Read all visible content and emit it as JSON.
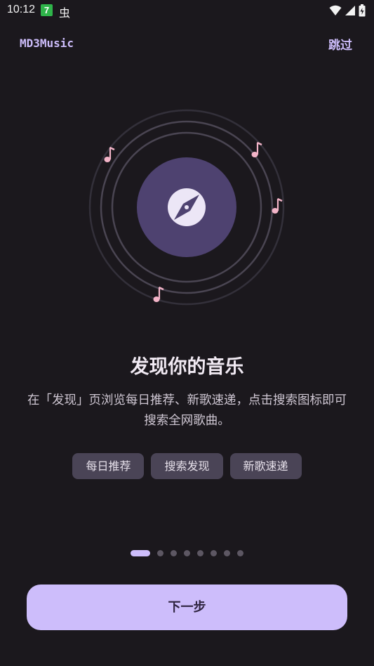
{
  "status_bar": {
    "time": "10:12",
    "badge": "7",
    "bug_glyph": "虫"
  },
  "app": {
    "title": "MD3Music",
    "skip_label": "跳过"
  },
  "onboarding": {
    "heading": "发现你的音乐",
    "description": "在「发现」页浏览每日推荐、新歌速递，点击搜索图标即可搜索全网歌曲。",
    "chips": [
      "每日推荐",
      "搜索发现",
      "新歌速递"
    ],
    "page_count": 8,
    "current_page": 1,
    "next_label": "下一步"
  },
  "colors": {
    "background": "#1b181d",
    "accent": "#cdbdfb",
    "disc": "#4e4270",
    "note": "#f3b4c8",
    "chip": "#4a4456"
  },
  "icons": {
    "center": "compass-icon",
    "notes": "music-note-icon"
  }
}
